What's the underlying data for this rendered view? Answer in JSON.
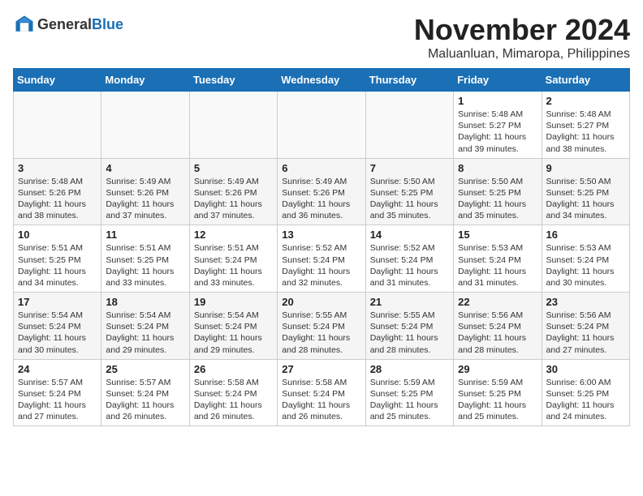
{
  "header": {
    "logo_general": "General",
    "logo_blue": "Blue",
    "month_year": "November 2024",
    "location": "Maluanluan, Mimaropa, Philippines"
  },
  "columns": [
    "Sunday",
    "Monday",
    "Tuesday",
    "Wednesday",
    "Thursday",
    "Friday",
    "Saturday"
  ],
  "weeks": [
    {
      "days": [
        {
          "num": "",
          "info": ""
        },
        {
          "num": "",
          "info": ""
        },
        {
          "num": "",
          "info": ""
        },
        {
          "num": "",
          "info": ""
        },
        {
          "num": "",
          "info": ""
        },
        {
          "num": "1",
          "info": "Sunrise: 5:48 AM\nSunset: 5:27 PM\nDaylight: 11 hours\nand 39 minutes."
        },
        {
          "num": "2",
          "info": "Sunrise: 5:48 AM\nSunset: 5:27 PM\nDaylight: 11 hours\nand 38 minutes."
        }
      ]
    },
    {
      "days": [
        {
          "num": "3",
          "info": "Sunrise: 5:48 AM\nSunset: 5:26 PM\nDaylight: 11 hours\nand 38 minutes."
        },
        {
          "num": "4",
          "info": "Sunrise: 5:49 AM\nSunset: 5:26 PM\nDaylight: 11 hours\nand 37 minutes."
        },
        {
          "num": "5",
          "info": "Sunrise: 5:49 AM\nSunset: 5:26 PM\nDaylight: 11 hours\nand 37 minutes."
        },
        {
          "num": "6",
          "info": "Sunrise: 5:49 AM\nSunset: 5:26 PM\nDaylight: 11 hours\nand 36 minutes."
        },
        {
          "num": "7",
          "info": "Sunrise: 5:50 AM\nSunset: 5:25 PM\nDaylight: 11 hours\nand 35 minutes."
        },
        {
          "num": "8",
          "info": "Sunrise: 5:50 AM\nSunset: 5:25 PM\nDaylight: 11 hours\nand 35 minutes."
        },
        {
          "num": "9",
          "info": "Sunrise: 5:50 AM\nSunset: 5:25 PM\nDaylight: 11 hours\nand 34 minutes."
        }
      ]
    },
    {
      "days": [
        {
          "num": "10",
          "info": "Sunrise: 5:51 AM\nSunset: 5:25 PM\nDaylight: 11 hours\nand 34 minutes."
        },
        {
          "num": "11",
          "info": "Sunrise: 5:51 AM\nSunset: 5:25 PM\nDaylight: 11 hours\nand 33 minutes."
        },
        {
          "num": "12",
          "info": "Sunrise: 5:51 AM\nSunset: 5:24 PM\nDaylight: 11 hours\nand 33 minutes."
        },
        {
          "num": "13",
          "info": "Sunrise: 5:52 AM\nSunset: 5:24 PM\nDaylight: 11 hours\nand 32 minutes."
        },
        {
          "num": "14",
          "info": "Sunrise: 5:52 AM\nSunset: 5:24 PM\nDaylight: 11 hours\nand 31 minutes."
        },
        {
          "num": "15",
          "info": "Sunrise: 5:53 AM\nSunset: 5:24 PM\nDaylight: 11 hours\nand 31 minutes."
        },
        {
          "num": "16",
          "info": "Sunrise: 5:53 AM\nSunset: 5:24 PM\nDaylight: 11 hours\nand 30 minutes."
        }
      ]
    },
    {
      "days": [
        {
          "num": "17",
          "info": "Sunrise: 5:54 AM\nSunset: 5:24 PM\nDaylight: 11 hours\nand 30 minutes."
        },
        {
          "num": "18",
          "info": "Sunrise: 5:54 AM\nSunset: 5:24 PM\nDaylight: 11 hours\nand 29 minutes."
        },
        {
          "num": "19",
          "info": "Sunrise: 5:54 AM\nSunset: 5:24 PM\nDaylight: 11 hours\nand 29 minutes."
        },
        {
          "num": "20",
          "info": "Sunrise: 5:55 AM\nSunset: 5:24 PM\nDaylight: 11 hours\nand 28 minutes."
        },
        {
          "num": "21",
          "info": "Sunrise: 5:55 AM\nSunset: 5:24 PM\nDaylight: 11 hours\nand 28 minutes."
        },
        {
          "num": "22",
          "info": "Sunrise: 5:56 AM\nSunset: 5:24 PM\nDaylight: 11 hours\nand 28 minutes."
        },
        {
          "num": "23",
          "info": "Sunrise: 5:56 AM\nSunset: 5:24 PM\nDaylight: 11 hours\nand 27 minutes."
        }
      ]
    },
    {
      "days": [
        {
          "num": "24",
          "info": "Sunrise: 5:57 AM\nSunset: 5:24 PM\nDaylight: 11 hours\nand 27 minutes."
        },
        {
          "num": "25",
          "info": "Sunrise: 5:57 AM\nSunset: 5:24 PM\nDaylight: 11 hours\nand 26 minutes."
        },
        {
          "num": "26",
          "info": "Sunrise: 5:58 AM\nSunset: 5:24 PM\nDaylight: 11 hours\nand 26 minutes."
        },
        {
          "num": "27",
          "info": "Sunrise: 5:58 AM\nSunset: 5:24 PM\nDaylight: 11 hours\nand 26 minutes."
        },
        {
          "num": "28",
          "info": "Sunrise: 5:59 AM\nSunset: 5:25 PM\nDaylight: 11 hours\nand 25 minutes."
        },
        {
          "num": "29",
          "info": "Sunrise: 5:59 AM\nSunset: 5:25 PM\nDaylight: 11 hours\nand 25 minutes."
        },
        {
          "num": "30",
          "info": "Sunrise: 6:00 AM\nSunset: 5:25 PM\nDaylight: 11 hours\nand 24 minutes."
        }
      ]
    }
  ]
}
